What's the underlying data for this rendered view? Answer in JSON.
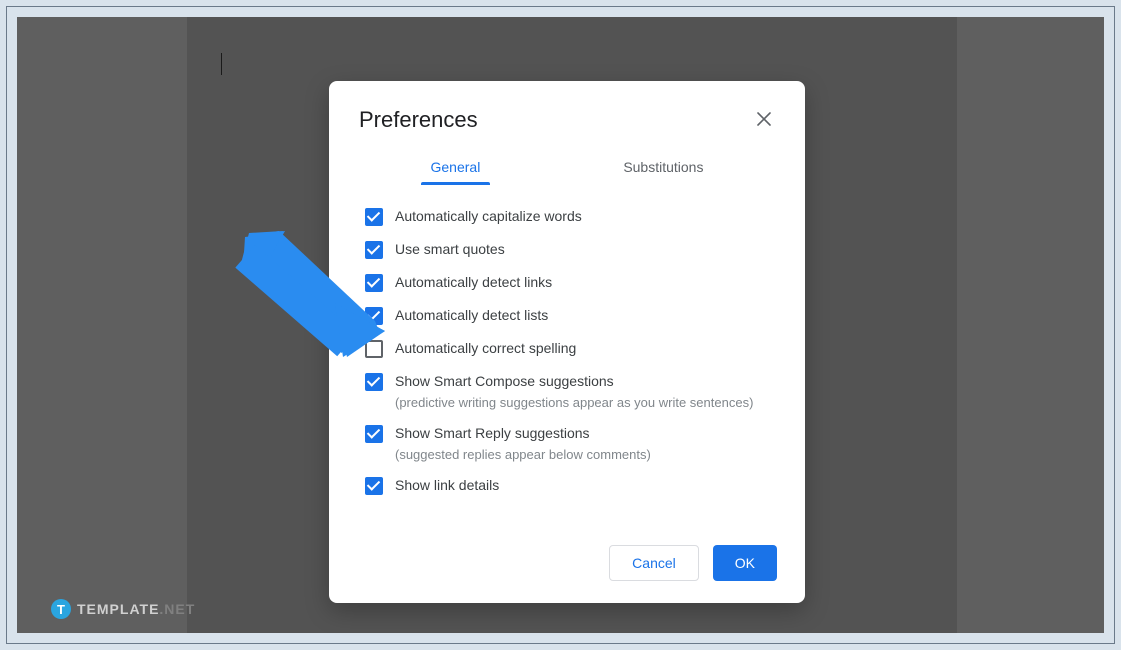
{
  "dialog": {
    "title": "Preferences",
    "tabs": {
      "general": "General",
      "substitutions": "Substitutions"
    },
    "options": [
      {
        "label": "Automatically capitalize words",
        "checked": true
      },
      {
        "label": "Use smart quotes",
        "checked": true
      },
      {
        "label": "Automatically detect links",
        "checked": true
      },
      {
        "label": "Automatically detect lists",
        "checked": true
      },
      {
        "label": "Automatically correct spelling",
        "checked": false
      },
      {
        "label": "Show Smart Compose suggestions",
        "sub": "(predictive writing suggestions appear as you write sentences)",
        "checked": true
      },
      {
        "label": "Show Smart Reply suggestions",
        "sub": "(suggested replies appear below comments)",
        "checked": true
      },
      {
        "label": "Show link details",
        "checked": true
      }
    ],
    "buttons": {
      "cancel": "Cancel",
      "ok": "OK"
    }
  },
  "watermark": {
    "badge": "T",
    "name": "TEMPLATE",
    "suffix": ".NET"
  }
}
